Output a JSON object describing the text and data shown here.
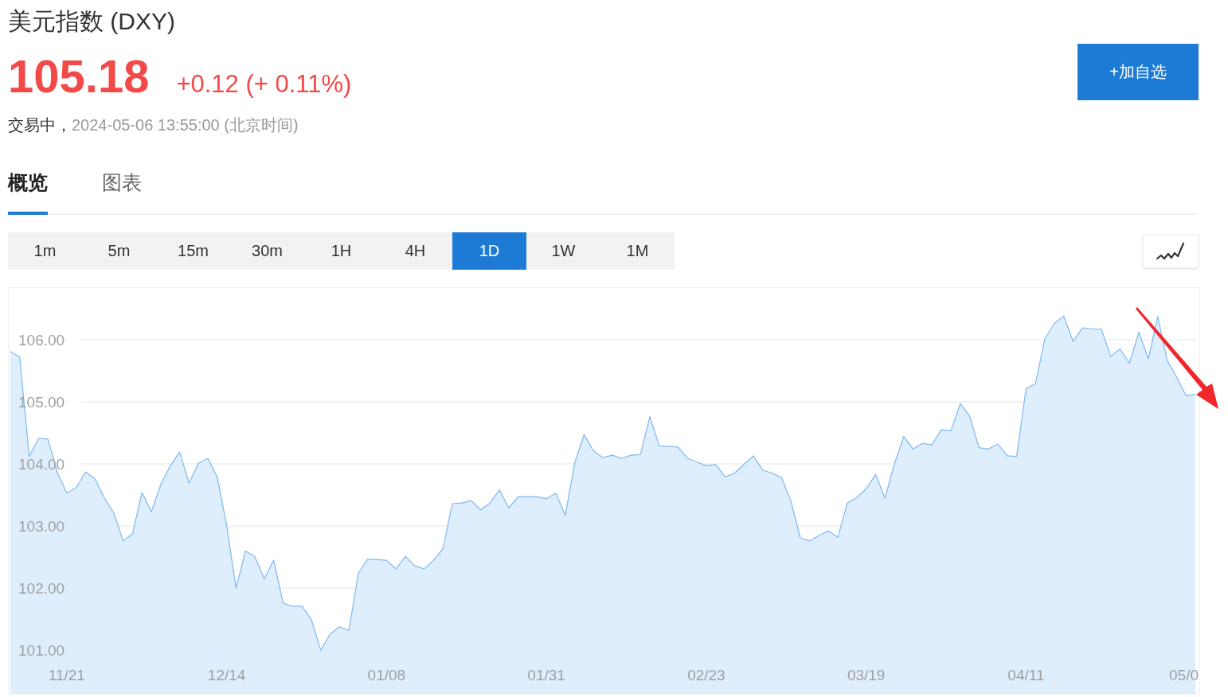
{
  "header": {
    "title": "美元指数 (DXY)",
    "price": "105.18",
    "change": "+0.12 (+ 0.11%)",
    "status": "交易中，",
    "timestamp": "2024-05-06 13:55:00 (北京时间)"
  },
  "watchlist_button": {
    "label": "+加自选"
  },
  "tabs": [
    {
      "label": "概览",
      "selected": true
    },
    {
      "label": "图表",
      "selected": false
    }
  ],
  "intervals": [
    {
      "label": "1m",
      "selected": false
    },
    {
      "label": "5m",
      "selected": false
    },
    {
      "label": "15m",
      "selected": false
    },
    {
      "label": "30m",
      "selected": false
    },
    {
      "label": "1H",
      "selected": false
    },
    {
      "label": "4H",
      "selected": false
    },
    {
      "label": "1D",
      "selected": true
    },
    {
      "label": "1W",
      "selected": false
    },
    {
      "label": "1M",
      "selected": false
    }
  ],
  "chart": {
    "chart_data": {
      "type": "area",
      "grid": true,
      "categories": [
        null,
        null,
        null,
        null,
        null,
        null,
        "11/21",
        null,
        null,
        null,
        null,
        null,
        null,
        null,
        null,
        null,
        null,
        null,
        null,
        null,
        null,
        null,
        null,
        "12/14",
        null,
        null,
        null,
        null,
        null,
        null,
        null,
        null,
        null,
        null,
        null,
        null,
        null,
        null,
        null,
        null,
        "01/08",
        null,
        null,
        null,
        null,
        null,
        null,
        null,
        null,
        null,
        null,
        null,
        null,
        null,
        null,
        null,
        null,
        "01/31",
        null,
        null,
        null,
        null,
        null,
        null,
        null,
        null,
        null,
        null,
        null,
        null,
        null,
        null,
        null,
        null,
        "02/23",
        null,
        null,
        null,
        null,
        null,
        null,
        null,
        null,
        null,
        null,
        null,
        null,
        null,
        null,
        null,
        null,
        "03/19",
        null,
        null,
        null,
        null,
        null,
        null,
        null,
        null,
        null,
        null,
        null,
        null,
        null,
        null,
        null,
        null,
        "04/11",
        null,
        null,
        null,
        null,
        null,
        null,
        null,
        null,
        null,
        null,
        null,
        null,
        null,
        null,
        null,
        null,
        "05/0",
        null
      ],
      "ylim": [
        100.3,
        106.83
      ],
      "yticks": [
        {
          "value": 101,
          "label": "101.00"
        },
        {
          "value": 102,
          "label": "102.00"
        },
        {
          "value": 103,
          "label": "103.00"
        },
        {
          "value": 104,
          "label": "104.00"
        },
        {
          "value": 105,
          "label": "105.00"
        },
        {
          "value": 106,
          "label": "106.00"
        }
      ],
      "series": [
        {
          "color": "#7cb8f2",
          "values": [
            105.81,
            105.72,
            104.12,
            104.41,
            104.4,
            103.86,
            103.53,
            103.62,
            103.87,
            103.76,
            103.45,
            103.21,
            102.76,
            102.88,
            103.54,
            103.23,
            103.67,
            103.97,
            104.19,
            103.69,
            104.01,
            104.09,
            103.79,
            103.01,
            102.0,
            102.6,
            102.51,
            102.15,
            102.45,
            101.76,
            101.71,
            101.71,
            101.5,
            101.0,
            101.26,
            101.38,
            101.32,
            102.24,
            102.47,
            102.46,
            102.45,
            102.31,
            102.51,
            102.36,
            102.31,
            102.45,
            102.63,
            103.36,
            103.37,
            103.41,
            103.26,
            103.37,
            103.58,
            103.29,
            103.47,
            103.47,
            103.47,
            103.44,
            103.53,
            103.17,
            104.01,
            104.47,
            104.21,
            104.1,
            104.14,
            104.09,
            104.14,
            104.15,
            104.76,
            104.29,
            104.28,
            104.27,
            104.09,
            104.03,
            103.97,
            103.99,
            103.79,
            103.85,
            103.99,
            104.13,
            103.9,
            103.85,
            103.78,
            103.4,
            102.81,
            102.76,
            102.85,
            102.92,
            102.82,
            103.37,
            103.46,
            103.6,
            103.83,
            103.45,
            104.0,
            104.44,
            104.24,
            104.33,
            104.31,
            104.55,
            104.53,
            104.97,
            104.77,
            104.26,
            104.24,
            104.32,
            104.13,
            104.12,
            105.21,
            105.29,
            106.01,
            106.26,
            106.38,
            105.97,
            106.19,
            106.17,
            106.17,
            105.73,
            105.85,
            105.62,
            106.12,
            105.69,
            106.37,
            105.67,
            105.4,
            105.1,
            105.12
          ]
        }
      ]
    }
  }
}
